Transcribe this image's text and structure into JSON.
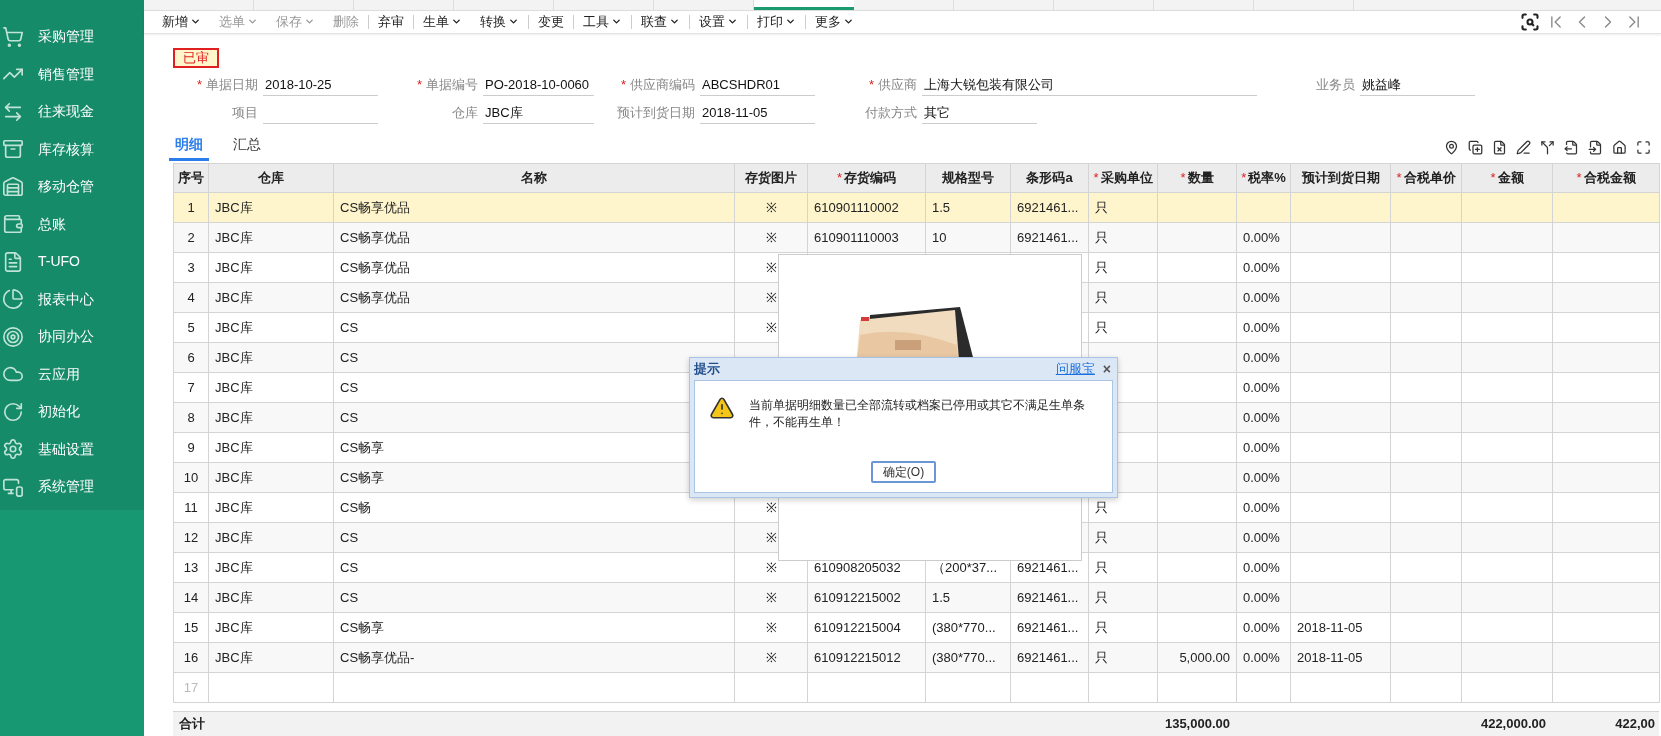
{
  "top_tabs": [
    {
      "selected": false
    },
    {
      "selected": false
    },
    {
      "selected": false
    },
    {
      "selected": false
    },
    {
      "selected": false
    },
    {
      "selected": false
    },
    {
      "selected": true
    },
    {
      "selected": false
    },
    {
      "selected": false
    },
    {
      "selected": false
    },
    {
      "selected": false
    },
    {
      "selected": false
    }
  ],
  "sidebar": {
    "items": [
      {
        "label": "采购管理",
        "kind": "cart"
      },
      {
        "label": "销售管理",
        "kind": "chart"
      },
      {
        "label": "往来现金",
        "kind": "exchange"
      },
      {
        "label": "库存核算",
        "kind": "stock"
      },
      {
        "label": "移动仓管",
        "kind": "warehouse"
      },
      {
        "label": "总账",
        "kind": "ledger"
      },
      {
        "label": "T-UFO",
        "kind": "ufo"
      },
      {
        "label": "报表中心",
        "kind": "report"
      },
      {
        "label": "协同办公",
        "kind": "office"
      },
      {
        "label": "云应用",
        "kind": "cloud"
      },
      {
        "label": "初始化",
        "kind": "init"
      },
      {
        "label": "基础设置",
        "kind": "settings"
      },
      {
        "label": "系统管理",
        "kind": "system"
      }
    ]
  },
  "toolbar": {
    "items": [
      {
        "label": "新增",
        "dropdown": true,
        "disabled": false,
        "divider_before": false
      },
      {
        "label": "选单",
        "dropdown": true,
        "disabled": true,
        "divider_before": false
      },
      {
        "label": "保存",
        "dropdown": true,
        "disabled": true,
        "divider_before": false
      },
      {
        "label": "删除",
        "dropdown": false,
        "disabled": true,
        "divider_before": false
      },
      {
        "label": "弃审",
        "dropdown": false,
        "disabled": false,
        "divider_before": true
      },
      {
        "label": "生单",
        "dropdown": true,
        "disabled": false,
        "divider_before": true
      },
      {
        "label": "转换",
        "dropdown": true,
        "disabled": false,
        "divider_before": false
      },
      {
        "label": "变更",
        "dropdown": false,
        "disabled": false,
        "divider_before": true
      },
      {
        "label": "工具",
        "dropdown": true,
        "disabled": false,
        "divider_before": true
      },
      {
        "label": "联查",
        "dropdown": true,
        "disabled": false,
        "divider_before": true
      },
      {
        "label": "设置",
        "dropdown": true,
        "disabled": false,
        "divider_before": true
      },
      {
        "label": "打印",
        "dropdown": true,
        "disabled": false,
        "divider_before": true
      },
      {
        "label": "更多",
        "dropdown": true,
        "disabled": false,
        "divider_before": true
      }
    ],
    "nav": [
      {
        "kind": "search"
      },
      {
        "kind": "first"
      },
      {
        "kind": "prev"
      },
      {
        "kind": "next"
      },
      {
        "kind": "last"
      }
    ]
  },
  "status_badge": "已审",
  "form": {
    "rows": [
      [
        {
          "mark": "*",
          "label": "单据日期",
          "value": "2018-10-25"
        },
        {
          "mark": "*",
          "label": "单据编号",
          "value": "PO-2018-10-0060"
        },
        {
          "mark": "*",
          "label": "供应商编码",
          "value": "ABCSHDR01"
        },
        {
          "mark": "*",
          "label": "供应商",
          "value": "上海大锐包装有限公司"
        },
        {
          "label": "业务员",
          "value": "姚益峰"
        }
      ],
      [
        {
          "label": "项目"
        },
        {
          "label": "仓库",
          "value": "JBC库"
        },
        {
          "label": "预计到货日期",
          "value": "2018-11-05"
        },
        {
          "label": "付款方式",
          "value": "其它"
        }
      ]
    ]
  },
  "detail_tabs": [
    {
      "label": "明细",
      "selected": true
    },
    {
      "label": "汇总",
      "selected": false
    }
  ],
  "grid_tools": [
    {
      "kind": "pin"
    },
    {
      "kind": "copy"
    },
    {
      "kind": "delete"
    },
    {
      "kind": "edit"
    },
    {
      "kind": "split"
    },
    {
      "kind": "export"
    },
    {
      "kind": "import"
    },
    {
      "kind": "home"
    },
    {
      "kind": "fullscreen"
    }
  ],
  "table": {
    "columns": [
      {
        "label": "序号"
      },
      {
        "label": "仓库"
      },
      {
        "label": "名称"
      },
      {
        "label": "存货图片"
      },
      {
        "mark": "*",
        "label": "存货编码"
      },
      {
        "label": "规格型号"
      },
      {
        "label": "条形码a"
      },
      {
        "mark": "*",
        "label": "采购单位"
      },
      {
        "mark": "*",
        "label": "数量"
      },
      {
        "mark": "*",
        "label": "税率%"
      },
      {
        "label": "预计到货日期"
      },
      {
        "mark": "*",
        "label": "合税单价"
      },
      {
        "mark": "*",
        "label": "金额"
      },
      {
        "mark": "*",
        "label": "合税金额"
      }
    ],
    "rows": [
      {
        "selected": true,
        "cells": [
          "1",
          "JBC库",
          "CS畅享优品",
          "※",
          "610901110002",
          "1.5",
          "6921461...",
          "只",
          null,
          null,
          null,
          null,
          null,
          null
        ]
      },
      {
        "selected": false,
        "cells": [
          "2",
          "JBC库",
          "CS畅享优品",
          "※",
          "610901110003",
          "10",
          "6921461...",
          "只",
          null,
          "0.00%",
          null,
          null,
          null,
          null
        ]
      },
      {
        "selected": false,
        "cells": [
          "3",
          "JBC库",
          "CS畅享优品",
          "※",
          null,
          null,
          null,
          "只",
          null,
          "0.00%",
          null,
          null,
          null,
          null
        ]
      },
      {
        "selected": false,
        "cells": [
          "4",
          "JBC库",
          "CS畅享优品",
          "※",
          null,
          null,
          null,
          "只",
          null,
          "0.00%",
          null,
          null,
          null,
          null
        ]
      },
      {
        "selected": false,
        "cells": [
          "5",
          "JBC库",
          "CS",
          "※",
          null,
          null,
          null,
          "只",
          null,
          "0.00%",
          null,
          null,
          null,
          null
        ]
      },
      {
        "selected": false,
        "cells": [
          "6",
          "JBC库",
          "CS",
          null,
          null,
          null,
          null,
          null,
          null,
          "0.00%",
          null,
          null,
          null,
          null
        ]
      },
      {
        "selected": false,
        "cells": [
          "7",
          "JBC库",
          "CS",
          null,
          null,
          null,
          null,
          null,
          null,
          "0.00%",
          null,
          null,
          null,
          null
        ]
      },
      {
        "selected": false,
        "cells": [
          "8",
          "JBC库",
          "CS",
          null,
          null,
          null,
          null,
          null,
          null,
          "0.00%",
          null,
          null,
          null,
          null
        ]
      },
      {
        "selected": false,
        "cells": [
          "9",
          "JBC库",
          "CS畅享",
          null,
          null,
          null,
          null,
          null,
          null,
          "0.00%",
          null,
          null,
          null,
          null
        ]
      },
      {
        "selected": false,
        "cells": [
          "10",
          "JBC库",
          "CS畅享",
          null,
          null,
          null,
          null,
          null,
          null,
          "0.00%",
          null,
          null,
          null,
          null
        ]
      },
      {
        "selected": false,
        "cells": [
          "11",
          "JBC库",
          "CS畅",
          "※",
          null,
          null,
          null,
          "只",
          null,
          "0.00%",
          null,
          null,
          null,
          null
        ]
      },
      {
        "selected": false,
        "cells": [
          "12",
          "JBC库",
          "CS",
          "※",
          null,
          null,
          null,
          "只",
          null,
          "0.00%",
          null,
          null,
          null,
          null
        ]
      },
      {
        "selected": false,
        "cells": [
          "13",
          "JBC库",
          "CS",
          "※",
          "610908205032",
          "（200*37...",
          "6921461...",
          "只",
          null,
          "0.00%",
          null,
          null,
          null,
          null
        ]
      },
      {
        "selected": false,
        "cells": [
          "14",
          "JBC库",
          "CS",
          "※",
          "610912215002",
          "1.5",
          "6921461...",
          "只",
          null,
          "0.00%",
          null,
          null,
          null,
          null
        ]
      },
      {
        "selected": false,
        "cells": [
          "15",
          "JBC库",
          "CS畅享",
          "※",
          "610912215004",
          "(380*770...",
          "6921461...",
          "只",
          null,
          "0.00%",
          "2018-11-05",
          null,
          null,
          null
        ]
      },
      {
        "selected": false,
        "cells": [
          "16",
          "JBC库",
          "CS畅享优品-",
          "※",
          "610912215012",
          "(380*770...",
          "6921461...",
          "只",
          "5,000.00",
          "0.00%",
          "2018-11-05",
          null,
          null,
          null
        ]
      },
      {
        "selected": false,
        "cells": [
          "17",
          null,
          null,
          null,
          null,
          null,
          null,
          null,
          null,
          null,
          null,
          null,
          null,
          null
        ]
      }
    ],
    "footer": {
      "label": "合计",
      "quantity": "135,000.00",
      "amount": "422,000.00",
      "tax_amount": "422,00"
    }
  },
  "dialog": {
    "title": "提示",
    "help_link": "问服宝",
    "close": "×",
    "message": "当前单据明细数量已全部流转或档案已停用或其它不满足生单条件，不能再生单！",
    "button": "确定(O)"
  }
}
